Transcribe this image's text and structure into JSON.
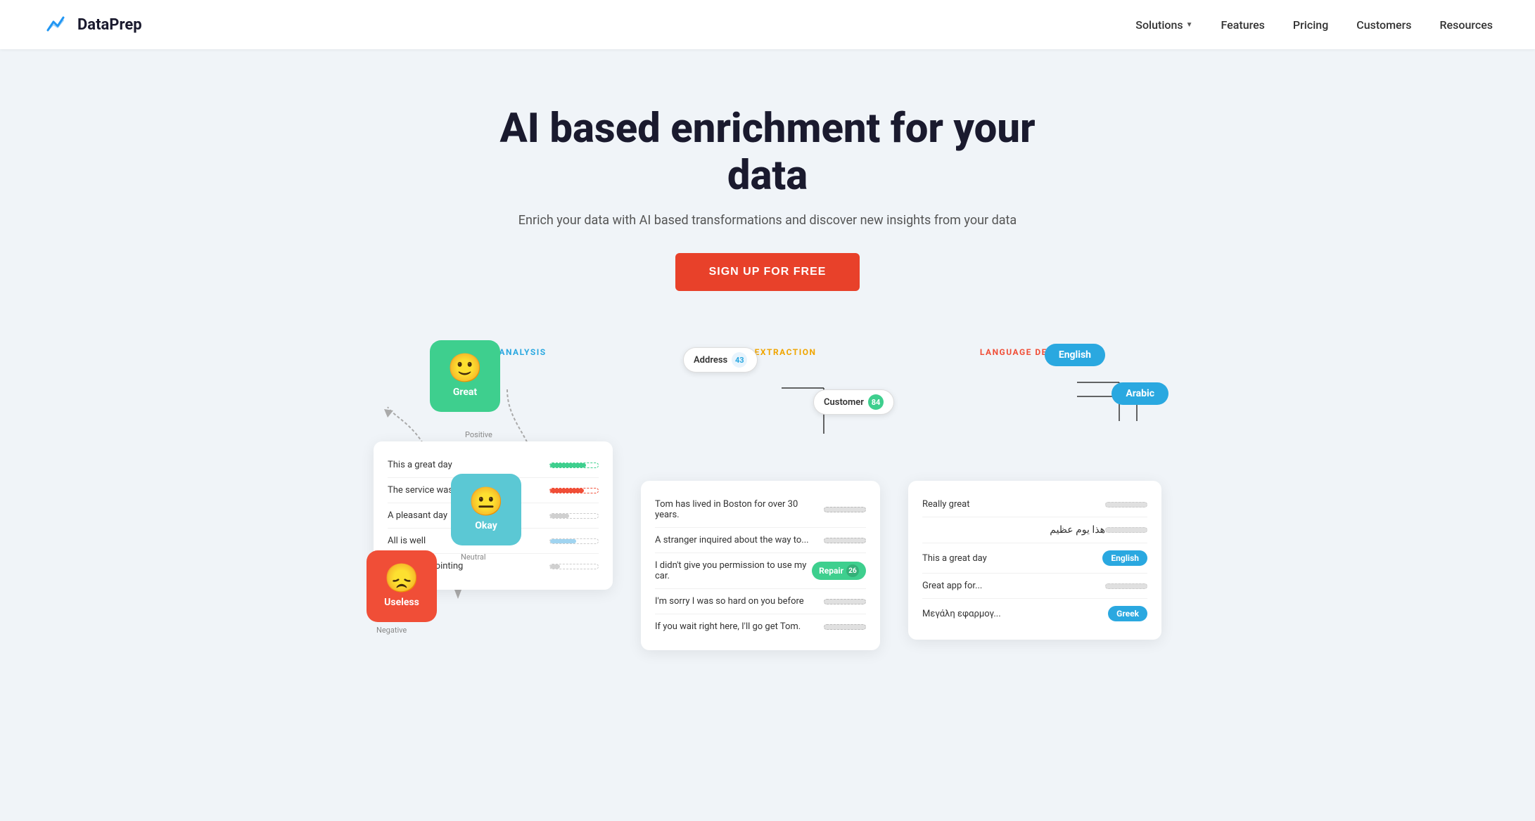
{
  "nav": {
    "brand": "DataPrep",
    "links": [
      {
        "label": "Solutions",
        "has_dropdown": true
      },
      {
        "label": "Features",
        "has_dropdown": false
      },
      {
        "label": "Pricing",
        "has_dropdown": false
      },
      {
        "label": "Customers",
        "has_dropdown": false
      },
      {
        "label": "Resources",
        "has_dropdown": false
      }
    ]
  },
  "hero": {
    "heading": "AI based enrichment for your data",
    "subheading": "Enrich your data with AI based transformations and discover new insights from your data",
    "cta": "SIGN UP FOR FREE"
  },
  "sentiment": {
    "section_label": "SENTIMENT ANALYSIS",
    "great_label": "Great",
    "great_sublabel": "Positive",
    "okay_label": "Okay",
    "okay_sublabel": "Neutral",
    "useless_label": "Useless",
    "useless_sublabel": "Negative",
    "rows": [
      {
        "text": "This a great day",
        "bar_type": "green"
      },
      {
        "text": "The service was slow",
        "bar_type": "red"
      },
      {
        "text": "A pleasant day",
        "bar_type": "gray"
      },
      {
        "text": "All is well",
        "bar_type": "light-blue"
      },
      {
        "text": "Very disappointing",
        "bar_type": "gray"
      }
    ]
  },
  "keywords": {
    "section_label": "KEYWORD EXTRACTION",
    "address_tag": "Address",
    "address_count": "43",
    "customer_tag": "Customer",
    "customer_count": "84",
    "rows": [
      {
        "text": "Tom has lived in Boston for over 30 years.",
        "tag": null
      },
      {
        "text": "A stranger inquired about the way to...",
        "tag": null
      },
      {
        "text": "I didn't give you permission to use my car.",
        "tag": "Repair 26"
      },
      {
        "text": "I'm sorry I was so hard on you before",
        "tag": null
      },
      {
        "text": "If you wait right here, I'll go get Tom.",
        "tag": null
      }
    ]
  },
  "language": {
    "section_label": "LANGUAGE DETECTION",
    "english_tag": "English",
    "arabic_tag": "Arabic",
    "rows": [
      {
        "text": "Really great",
        "tag": null
      },
      {
        "text": "هذا يوم عظيم",
        "tag": null
      },
      {
        "text": "This a great day",
        "tag": "English"
      },
      {
        "text": "Great app for...",
        "tag": null
      },
      {
        "text": "Μεγάλη εφαρμογ...",
        "tag": "Greek"
      }
    ]
  }
}
